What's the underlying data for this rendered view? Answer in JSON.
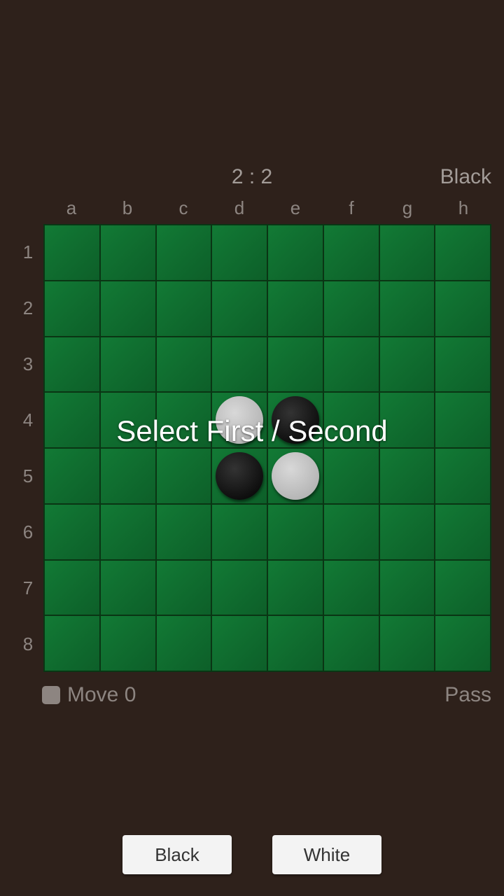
{
  "status": {
    "score": "2 : 2",
    "turn": "Black"
  },
  "board": {
    "cols": [
      "a",
      "b",
      "c",
      "d",
      "e",
      "f",
      "g",
      "h"
    ],
    "rows": [
      "1",
      "2",
      "3",
      "4",
      "5",
      "6",
      "7",
      "8"
    ],
    "pieces": [
      {
        "row": 4,
        "col": 4,
        "color": "white"
      },
      {
        "row": 4,
        "col": 5,
        "color": "black"
      },
      {
        "row": 5,
        "col": 4,
        "color": "black"
      },
      {
        "row": 5,
        "col": 5,
        "color": "white"
      }
    ]
  },
  "overlay": {
    "prompt": "Select First / Second"
  },
  "moveinfo": {
    "label": "Move 0",
    "pass": "Pass"
  },
  "buttons": {
    "black": "Black",
    "white": "White"
  }
}
